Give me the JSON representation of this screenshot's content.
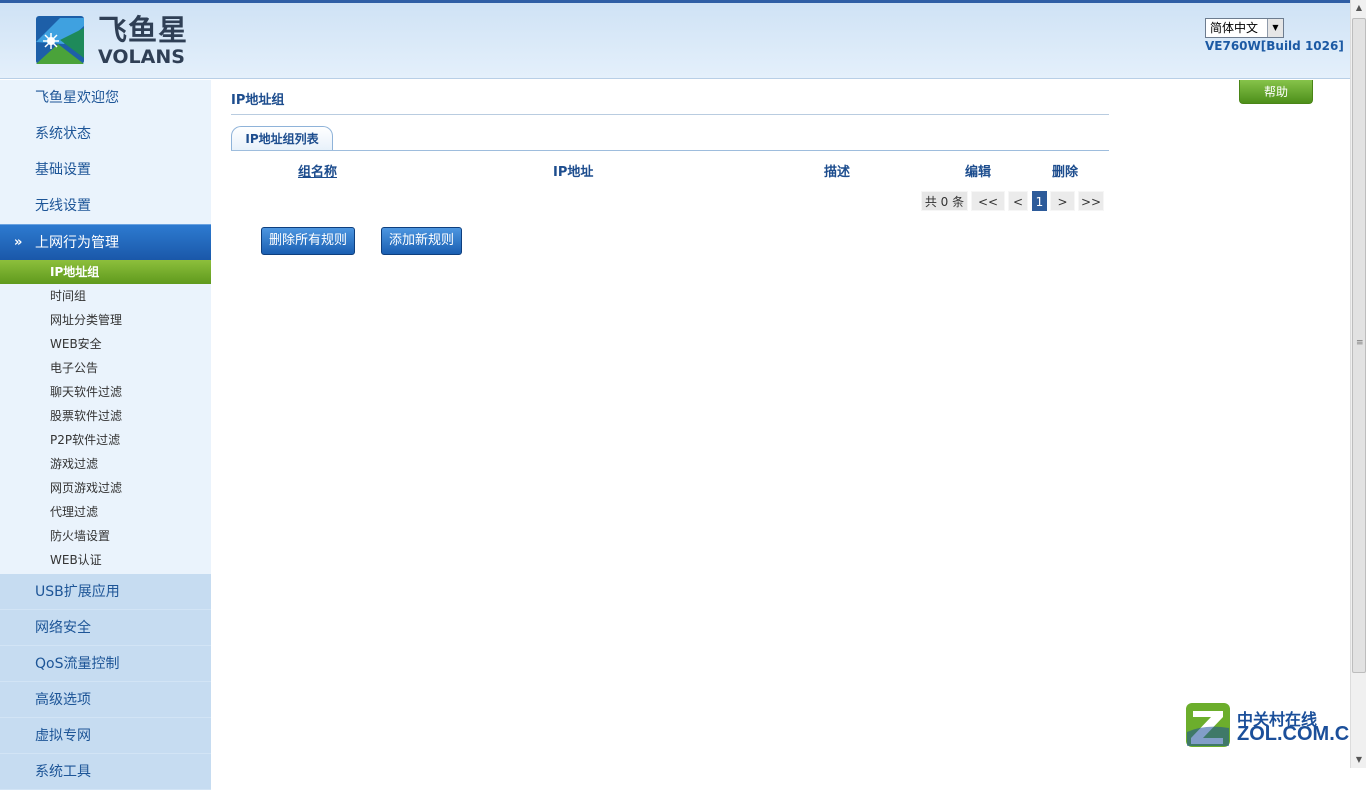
{
  "header": {
    "logo_cn": "飞鱼星",
    "logo_en": "VOLANS",
    "language": "简体中文",
    "version": "VE760W[Build 1026]"
  },
  "sidebar": {
    "top_items": [
      {
        "label": "飞鱼星欢迎您"
      },
      {
        "label": "系统状态"
      },
      {
        "label": "基础设置"
      },
      {
        "label": "无线设置"
      }
    ],
    "active_section": {
      "label": "上网行为管理"
    },
    "sub_items": [
      {
        "label": "IP地址组",
        "selected": true
      },
      {
        "label": "时间组"
      },
      {
        "label": "网址分类管理"
      },
      {
        "label": "WEB安全"
      },
      {
        "label": "电子公告"
      },
      {
        "label": "聊天软件过滤"
      },
      {
        "label": "股票软件过滤"
      },
      {
        "label": "P2P软件过滤"
      },
      {
        "label": "游戏过滤"
      },
      {
        "label": "网页游戏过滤"
      },
      {
        "label": "代理过滤"
      },
      {
        "label": "防火墙设置"
      },
      {
        "label": "WEB认证"
      }
    ],
    "bottom_items": [
      {
        "label": "USB扩展应用"
      },
      {
        "label": "网络安全"
      },
      {
        "label": "QoS流量控制"
      },
      {
        "label": "高级选项"
      },
      {
        "label": "虚拟专网"
      },
      {
        "label": "系统工具"
      }
    ]
  },
  "main": {
    "title": "IP地址组",
    "tab_label": "IP地址组列表",
    "columns": {
      "group_name": "组名称",
      "ip_address": "IP地址",
      "description": "描述",
      "edit": "编辑",
      "delete": "删除"
    },
    "pager": {
      "count": "共 0 条",
      "first": "<<",
      "prev": "<",
      "current": "1",
      "next": ">",
      "last": ">>"
    },
    "buttons": {
      "delete_all": "删除所有规则",
      "add_new": "添加新规则"
    }
  },
  "help_label": "帮助",
  "watermark": {
    "cn": "中关村在线",
    "en": "ZOL.COM.CN"
  },
  "colors": {
    "header_border": "#2f5ea5",
    "link_blue": "#1d4d8e",
    "active_green": "#5f9a1d",
    "button_blue": "#1a5fb2"
  },
  "icons": {
    "section_chevron": "double-chevron-down-icon"
  }
}
